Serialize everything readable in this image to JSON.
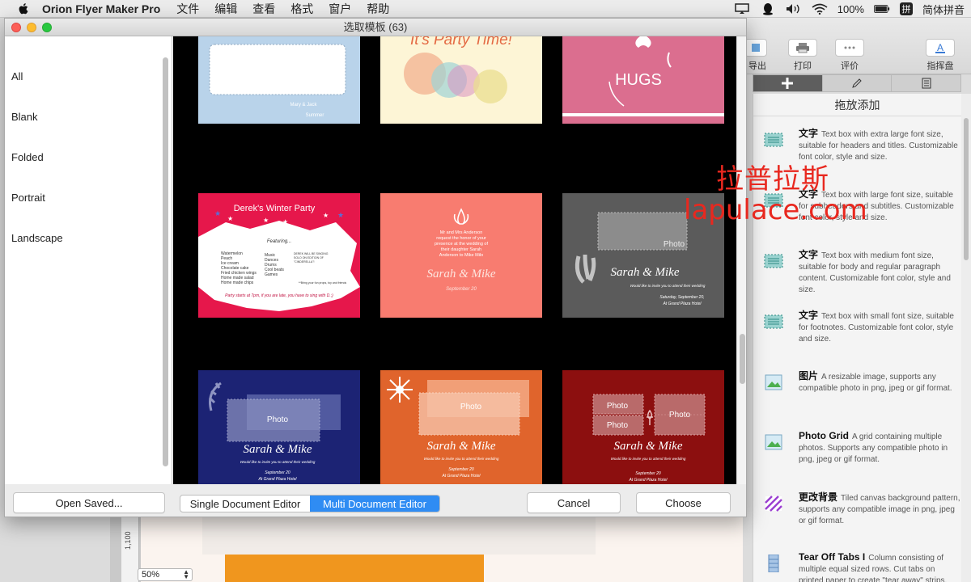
{
  "menubar": {
    "app_name": "Orion Flyer Maker Pro",
    "items": [
      "文件",
      "编辑",
      "查看",
      "格式",
      "窗户",
      "帮助"
    ],
    "battery": "100%",
    "input_method": "简体拼音",
    "input_method_badge": "拼"
  },
  "dialog": {
    "title": "选取模板 (63)",
    "categories": [
      "All",
      "Blank",
      "Folded",
      "Portrait",
      "Landscape"
    ],
    "buttons": {
      "open_saved": "Open Saved...",
      "cancel": "Cancel",
      "choose": "Choose"
    },
    "editor_mode": {
      "options": [
        "Single Document Editor",
        "Multi Document Editor"
      ],
      "selected": "Multi Document Editor"
    }
  },
  "templates": [
    {
      "id": "blank-card",
      "bg": "#b9d3ea",
      "texts": [
        "Mary & Jack",
        "Summer"
      ]
    },
    {
      "id": "party-time",
      "bg": "#fdf5d6",
      "texts": [
        "It's Party Time!"
      ]
    },
    {
      "id": "hugs",
      "bg": "#db6e8f",
      "texts": [
        "HUGS"
      ]
    },
    {
      "id": "dereks-party",
      "bg": "#e6174b",
      "texts": [
        "Derek's Winter Party",
        "Featuring...",
        "Watermelon",
        "Peach",
        "Ice cream",
        "Chocolate cake",
        "Fried chicken wings",
        "Home made salad",
        "Home made chips",
        "Music",
        "Dances",
        "Drums",
        "Cool beats",
        "Games",
        "DEREK WILL BE SINGING",
        "SOLO ON EDITION OF",
        "\"CINDERELLA\"!",
        "**Bring your fun props, toy and friends",
        "Party starts at 7pm, if you are late, you have to sing with D.;)"
      ]
    },
    {
      "id": "wedding-salmon",
      "bg": "#f87c70",
      "texts": [
        "Mr and Mrs Anderson",
        "request the honor of your",
        "presence at the wedding of",
        "their daughter Sarah",
        "Anderson to Mike Milo",
        "Sarah & Mike",
        "September 20"
      ]
    },
    {
      "id": "wedding-grey",
      "bg": "#5b5b5b",
      "texts": [
        "Photo",
        "Sarah & Mike",
        "Would like to invite you to attend their wedding",
        "Saturday, September 20,",
        "At Grand Plaza Hotel"
      ]
    },
    {
      "id": "wedding-navy",
      "bg": "#1c2374",
      "texts": [
        "Photo",
        "Sarah & Mike",
        "Would like to invite you to attend their wedding",
        "September 20",
        "At Grand Plaza Hotel"
      ]
    },
    {
      "id": "wedding-orange",
      "bg": "#e0642c",
      "texts": [
        "Photo",
        "Sarah & Mike",
        "Would like to invite you to attend their wedding",
        "September 20",
        "At Grand Plaza Hotel"
      ]
    },
    {
      "id": "wedding-red",
      "bg": "#8c0f0f",
      "texts": [
        "Photo",
        "Photo",
        "Photo",
        "Sarah & Mike",
        "Would like to invite you to attend their wedding",
        "September 20",
        "At Grand Plaza Hotel"
      ]
    }
  ],
  "toolbar": {
    "labels": [
      "导出",
      "打印",
      "评价",
      "指挥盘"
    ]
  },
  "side_panel": {
    "title": "拖放添加",
    "tools": [
      {
        "name": "文字",
        "desc": "Text box with extra large font size, suitable for headers and titles. Customizable font color, style and size."
      },
      {
        "name": "文字",
        "desc": "Text box with large font size, suitable for subheaders and subtitles. Customizable font color, style and size."
      },
      {
        "name": "文字",
        "desc": "Text box with medium font size, suitable for body and regular paragraph content. Customizable font color, style and size."
      },
      {
        "name": "文字",
        "desc": "Text box with small font size, suitable for footnotes. Customizable font color, style and size."
      },
      {
        "name": "图片",
        "desc": "A resizable image, supports any compatible photo in png, jpeg or gif format."
      },
      {
        "name": "Photo Grid",
        "desc": "A grid containing multiple photos.  Supports any compatible photo in png, jpeg or gif format."
      },
      {
        "name": "更改背景",
        "desc": "Tiled canvas background pattern, supports any compatible image in png, jpeg or gif format."
      },
      {
        "name": "Tear Off Tabs I",
        "desc": "Column consisting of multiple equal sized rows.  Cut tabs on printed paper to create \"tear away\" strips."
      }
    ]
  },
  "document": {
    "zoom": "50%",
    "ruler_label": "1,100"
  },
  "watermark": {
    "line1": "拉普拉斯",
    "line2": "lapulace.com"
  }
}
